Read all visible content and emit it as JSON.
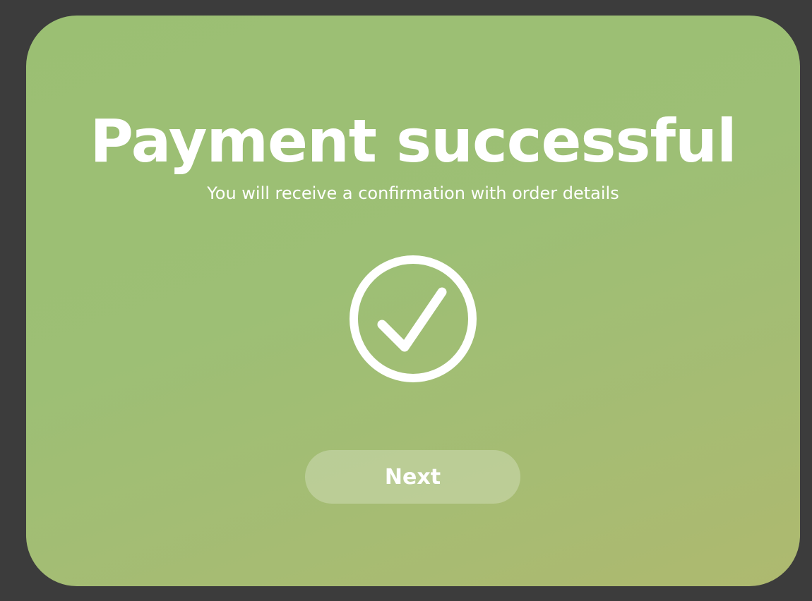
{
  "dialog": {
    "title": "Payment successful",
    "subtitle": "You will receive a confirmation with order details",
    "icon": "check-circle-icon",
    "next_label": "Next"
  },
  "colors": {
    "background": "#3c3c3c",
    "card": "#9dbf75",
    "text": "#ffffff"
  }
}
